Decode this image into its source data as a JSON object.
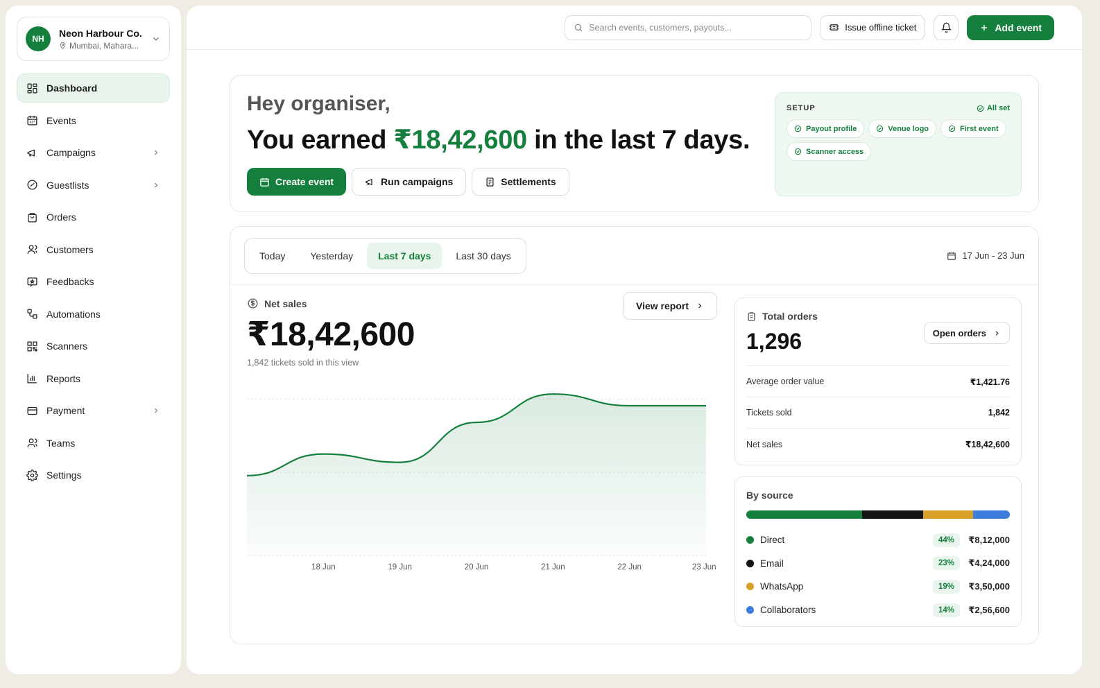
{
  "org": {
    "initials": "NH",
    "name": "Neon Harbour Co.",
    "location": "Mumbai, Mahara..."
  },
  "nav": [
    {
      "label": "Dashboard",
      "icon": "dashboard-icon",
      "active": true,
      "chevron": false
    },
    {
      "label": "Events",
      "icon": "calendar-icon",
      "active": false,
      "chevron": false
    },
    {
      "label": "Campaigns",
      "icon": "megaphone-icon",
      "active": false,
      "chevron": true
    },
    {
      "label": "Guestlists",
      "icon": "badge-check-icon",
      "active": false,
      "chevron": true
    },
    {
      "label": "Orders",
      "icon": "shopping-bag-icon",
      "active": false,
      "chevron": false
    },
    {
      "label": "Customers",
      "icon": "user-icon",
      "active": false,
      "chevron": false
    },
    {
      "label": "Feedbacks",
      "icon": "feedback-icon",
      "active": false,
      "chevron": false
    },
    {
      "label": "Automations",
      "icon": "workflow-icon",
      "active": false,
      "chevron": false
    },
    {
      "label": "Scanners",
      "icon": "qr-code-icon",
      "active": false,
      "chevron": false
    },
    {
      "label": "Reports",
      "icon": "bar-chart-icon",
      "active": false,
      "chevron": false
    },
    {
      "label": "Payment",
      "icon": "credit-card-icon",
      "active": false,
      "chevron": true
    },
    {
      "label": "Teams",
      "icon": "user-icon",
      "active": false,
      "chevron": false
    },
    {
      "label": "Settings",
      "icon": "gear-icon",
      "active": false,
      "chevron": false
    }
  ],
  "topbar": {
    "search_placeholder": "Search events, customers, payouts...",
    "offline_ticket": "Issue offline ticket",
    "add_event": "Add event"
  },
  "hero": {
    "greeting": "Hey organiser,",
    "line_prefix": "You earned ",
    "amount": "₹18,42,600",
    "line_suffix": " in the last 7 days.",
    "actions": {
      "create": "Create event",
      "campaigns": "Run campaigns",
      "settlements": "Settlements"
    }
  },
  "setup": {
    "title": "SETUP",
    "status": "All set",
    "chips": [
      "Payout profile",
      "Venue logo",
      "First event",
      "Scanner access"
    ]
  },
  "range": {
    "tabs": [
      "Today",
      "Yesterday",
      "Last 7 days",
      "Last 30 days"
    ],
    "active": "Last 7 days",
    "date_range": "17 Jun - 23 Jun"
  },
  "net_sales": {
    "label": "Net sales",
    "value": "₹18,42,600",
    "sub": "1,842 tickets sold in this view",
    "view_report": "View report"
  },
  "chart_data": {
    "type": "area",
    "x": [
      "17 Jun",
      "18 Jun",
      "19 Jun",
      "20 Jun",
      "21 Jun",
      "22 Jun",
      "23 Jun"
    ],
    "tick_labels": [
      "18 Jun",
      "19 Jun",
      "20 Jun",
      "21 Jun",
      "22 Jun",
      "23 Jun"
    ],
    "values": [
      0.48,
      0.61,
      0.56,
      0.8,
      0.97,
      0.9,
      0.9
    ],
    "ylim": [
      0,
      1
    ],
    "grid": true,
    "color": "#15803d"
  },
  "orders": {
    "label": "Total orders",
    "value": "1,296",
    "open_orders": "Open orders",
    "rows": [
      {
        "label": "Average order value",
        "value": "₹1,421.76"
      },
      {
        "label": "Tickets sold",
        "value": "1,842"
      },
      {
        "label": "Net sales",
        "value": "₹18,42,600"
      }
    ]
  },
  "by_source": {
    "title": "By source",
    "items": [
      {
        "name": "Direct",
        "pct": "44%",
        "share": 44,
        "amount": "₹8,12,000",
        "color": "#15803d"
      },
      {
        "name": "Email",
        "pct": "23%",
        "share": 23,
        "amount": "₹4,24,000",
        "color": "#151515"
      },
      {
        "name": "WhatsApp",
        "pct": "19%",
        "share": 19,
        "amount": "₹3,50,000",
        "color": "#d9a02a"
      },
      {
        "name": "Collaborators",
        "pct": "14%",
        "share": 14,
        "amount": "₹2,56,600",
        "color": "#3b7ddd"
      }
    ]
  }
}
